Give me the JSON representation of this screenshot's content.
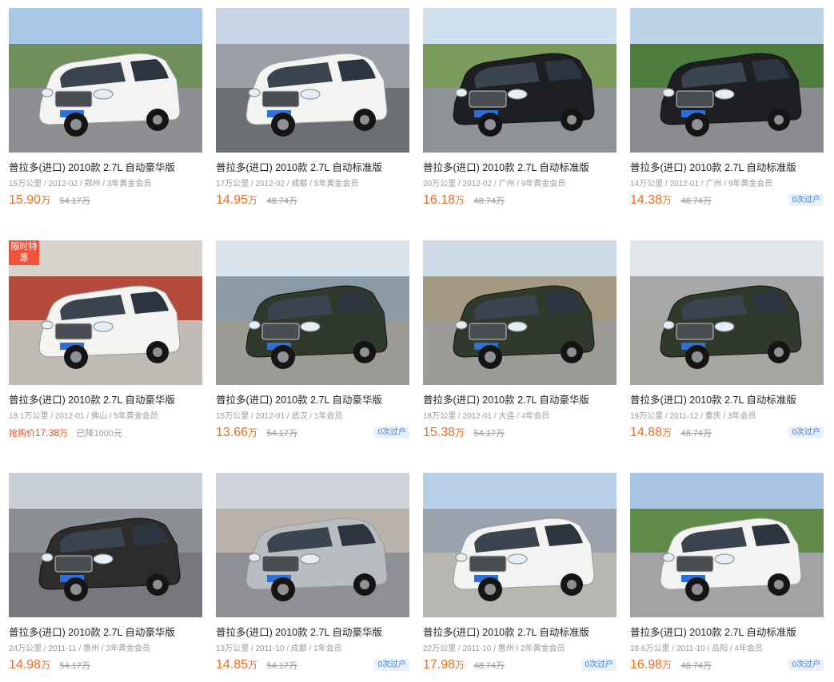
{
  "colors": {
    "price": "#f26b1d",
    "badge_text": "#3d7ee6",
    "badge_bg": "#e8f1fd",
    "promo_tag": "#f0533a"
  },
  "listings": [
    {
      "title": "普拉多(进口) 2010款 2.7L 自动豪华版",
      "meta": "15万公里 / 2012-02 / 郑州 / 3年黄金会员",
      "price": "15.90",
      "unit": "万",
      "original": "54.17万",
      "badge": "",
      "car_color": "white",
      "plate": "AL·5410Y"
    },
    {
      "title": "普拉多(进口) 2010款 2.7L 自动标准版",
      "meta": "17万公里 / 2012-02 / 成都 / 5年黄金会员",
      "price": "14.95",
      "unit": "万",
      "original": "48.74万",
      "badge": "",
      "car_color": "white",
      "plate": ""
    },
    {
      "title": "普拉多(进口) 2010款 2.7L 自动标准版",
      "meta": "20万公里 / 2012-02 / 广州 / 9年黄金会员",
      "price": "16.18",
      "unit": "万",
      "original": "48.74万",
      "badge": "",
      "car_color": "black",
      "plate": "VIP"
    },
    {
      "title": "普拉多(进口) 2010款 2.7L 自动标准版",
      "meta": "14万公里 / 2012-01 / 广州 / 9年黄金会员",
      "price": "14.38",
      "unit": "万",
      "original": "48.74万",
      "badge": "0次过户",
      "car_color": "black",
      "plate": ""
    },
    {
      "title": "普拉多(进口) 2010款 2.7L 自动豪华版",
      "meta": "18.1万公里 / 2012-01 / 佛山 / 5年黄金会员",
      "promo_prefix": "抢购价",
      "price": "17.38",
      "unit": "万",
      "discount": "已降1000元",
      "promo_tag": "限时特惠",
      "badge": "",
      "car_color": "white",
      "plate": ""
    },
    {
      "title": "普拉多(进口) 2010款 2.7L 自动豪华版",
      "meta": "15万公里 / 2012-01 / 武汉 / 1年会员",
      "price": "13.66",
      "unit": "万",
      "original": "54.17万",
      "badge": "0次过户",
      "car_color": "darkgreen",
      "plate": ""
    },
    {
      "title": "普拉多(进口) 2010款 2.7L 自动豪华版",
      "meta": "18万公里 / 2012-01 / 大连 / 4年会员",
      "price": "15.38",
      "unit": "万",
      "original": "54.17万",
      "badge": "",
      "car_color": "darkgreen",
      "plate": "B·36W6N"
    },
    {
      "title": "普拉多(进口) 2010款 2.7L 自动标准版",
      "meta": "19万公里 / 2011-12 / 重庆 / 3年会员",
      "price": "14.88",
      "unit": "万",
      "original": "48.74万",
      "badge": "0次过户",
      "car_color": "darkgreen",
      "plate": ""
    },
    {
      "title": "普拉多(进口) 2010款 2.7L 自动豪华版",
      "meta": "24万公里 / 2011-11 / 惠州 / 3年黄金会员",
      "price": "14.98",
      "unit": "万",
      "original": "54.17万",
      "badge": "",
      "car_color": "darkgray",
      "plate": ""
    },
    {
      "title": "普拉多(进口) 2010款 2.7L 自动豪华版",
      "meta": "13万公里 / 2011-10 / 成都 / 1年会员",
      "price": "14.85",
      "unit": "万",
      "original": "54.17万",
      "badge": "0次过户",
      "car_color": "silver",
      "plate": ""
    },
    {
      "title": "普拉多(进口) 2010款 2.7L 自动标准版",
      "meta": "22万公里 / 2011-10 / 惠州 / 2年黄金会员",
      "price": "17.98",
      "unit": "万",
      "original": "48.74万",
      "badge": "0次过户",
      "car_color": "white",
      "plate": ""
    },
    {
      "title": "普拉多(进口) 2010款 2.7L 自动标准版",
      "meta": "18.6万公里 / 2011-10 / 岳阳 / 4年会员",
      "price": "16.98",
      "unit": "万",
      "original": "48.74万",
      "badge": "0次过户",
      "car_color": "white",
      "plate": ""
    }
  ]
}
